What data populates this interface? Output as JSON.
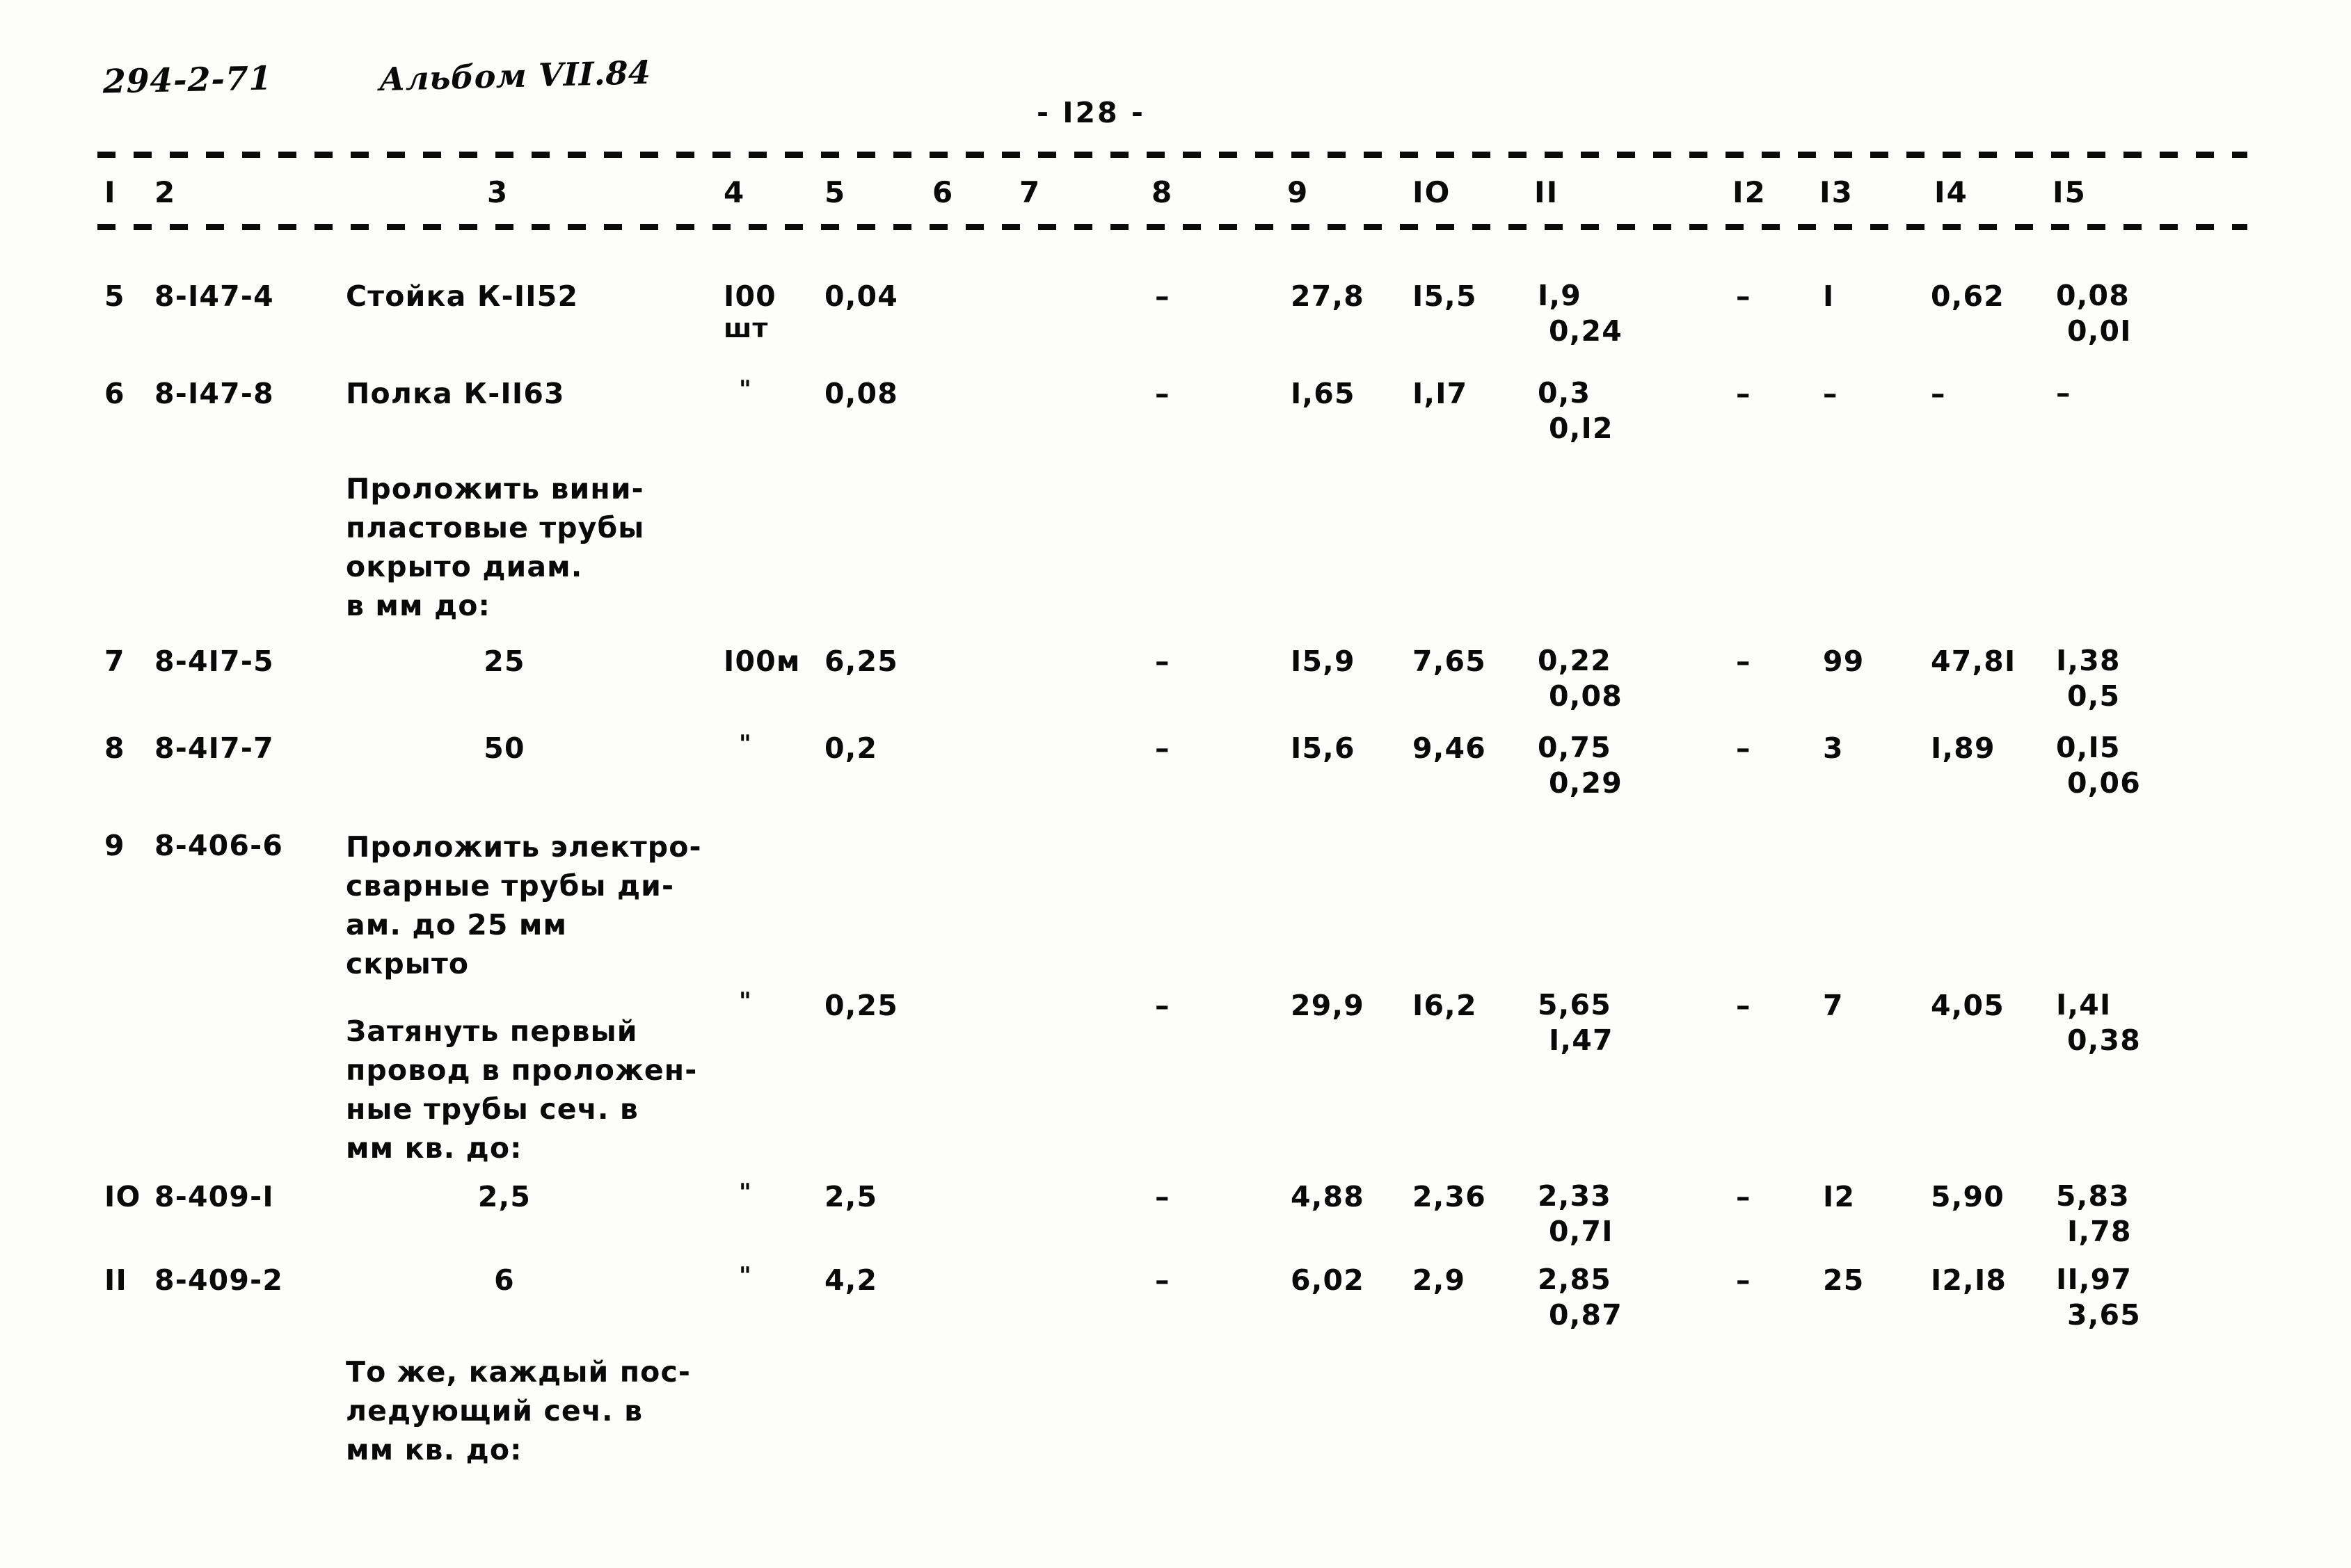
{
  "header": {
    "doc_code": "294-2-71",
    "album": "Альбом VII.84",
    "page_number": "- I28 -"
  },
  "table": {
    "column_headers": [
      "I",
      "2",
      "3",
      "4",
      "5",
      "6",
      "7",
      "8",
      "9",
      "IO",
      "II",
      "I2",
      "I3",
      "I4",
      "I5"
    ],
    "ditto_mark": "\"",
    "dash": "–",
    "rows": [
      {
        "kind": "data",
        "c1": "5",
        "c2": "8-I47-4",
        "c3": "Стойка К-II52",
        "c4": "I00",
        "c4_sub": "шт",
        "c5": "0,04",
        "c6": "",
        "c7": "",
        "c8": "–",
        "c9": "27,8",
        "c10": "I5,5",
        "c11_top": "I,9",
        "c11_bot": "0,24",
        "c12": "–",
        "c13": "I",
        "c14": "0,62",
        "c15_top": "0,08",
        "c15_bot": "0,0I"
      },
      {
        "kind": "data",
        "c1": "6",
        "c2": "8-I47-8",
        "c3": "Полка К-II63",
        "c4": "\"",
        "c4_sub": "",
        "c5": "0,08",
        "c6": "",
        "c7": "",
        "c8": "–",
        "c9": "I,65",
        "c10": "I,I7",
        "c11_top": "0,3",
        "c11_bot": "0,I2",
        "c12": "–",
        "c13": "–",
        "c14": "–",
        "c15_top": "–",
        "c15_bot": ""
      },
      {
        "kind": "note",
        "text": "Проложить вини-\nпластовые трубы\nокрыто диам.\nв мм до:"
      },
      {
        "kind": "data",
        "c1": "7",
        "c2": "8-4I7-5",
        "c3": "25",
        "c3_align": "center",
        "c4": "I00м",
        "c4_sub": "",
        "c5": "6,25",
        "c6": "",
        "c7": "",
        "c8": "–",
        "c9": "I5,9",
        "c10": "7,65",
        "c11_top": "0,22",
        "c11_bot": "0,08",
        "c12": "–",
        "c13": "99",
        "c14": "47,8I",
        "c15_top": "I,38",
        "c15_bot": "0,5"
      },
      {
        "kind": "data",
        "c1": "8",
        "c2": "8-4I7-7",
        "c3": "50",
        "c3_align": "center",
        "c4": "\"",
        "c4_sub": "",
        "c5": "0,2",
        "c6": "",
        "c7": "",
        "c8": "–",
        "c9": "I5,6",
        "c10": "9,46",
        "c11_top": "0,75",
        "c11_bot": "0,29",
        "c12": "–",
        "c13": "3",
        "c14": "I,89",
        "c15_top": "0,I5",
        "c15_bot": "0,06"
      },
      {
        "kind": "data-multiline",
        "c1": "9",
        "c2": "8-406-6",
        "c3": "Проложить электро-\nсварные трубы ди-\nам. до 25 мм\nскрыто",
        "c4": "\"",
        "c4_sub": "",
        "c5": "0,25",
        "c6": "",
        "c7": "",
        "c8": "–",
        "c9": "29,9",
        "c10": "I6,2",
        "c11_top": "5,65",
        "c11_bot": "I,47",
        "c12": "–",
        "c13": "7",
        "c14": "4,05",
        "c15_top": "I,4I",
        "c15_bot": "0,38"
      },
      {
        "kind": "note",
        "text": "Затянуть первый\nпровод в проложен-\nные трубы сеч. в\nмм кв. до:"
      },
      {
        "kind": "data",
        "c1": "IO",
        "c2": "8-409-I",
        "c3": "2,5",
        "c3_align": "center",
        "c4": "\"",
        "c4_sub": "",
        "c5": "2,5",
        "c6": "",
        "c7": "",
        "c8": "–",
        "c9": "4,88",
        "c10": "2,36",
        "c11_top": "2,33",
        "c11_bot": "0,7I",
        "c12": "–",
        "c13": "I2",
        "c14": "5,90",
        "c15_top": "5,83",
        "c15_bot": "I,78"
      },
      {
        "kind": "data",
        "c1": "II",
        "c2": "8-409-2",
        "c3": "6",
        "c3_align": "center",
        "c4": "\"",
        "c4_sub": "",
        "c5": "4,2",
        "c6": "",
        "c7": "",
        "c8": "–",
        "c9": "6,02",
        "c10": "2,9",
        "c11_top": "2,85",
        "c11_bot": "0,87",
        "c12": "–",
        "c13": "25",
        "c14": "I2,I8",
        "c15_top": "II,97",
        "c15_bot": "3,65"
      },
      {
        "kind": "note",
        "text": "То же, каждый пос-\nледующий сеч. в\nмм кв. до:"
      }
    ]
  }
}
